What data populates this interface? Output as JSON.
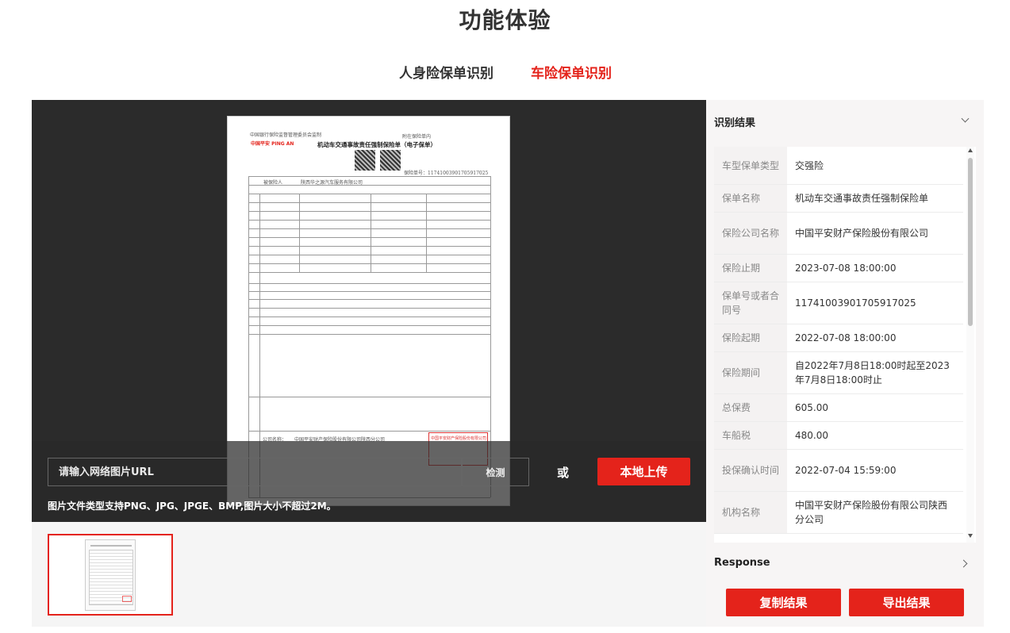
{
  "page": {
    "title": "功能体验"
  },
  "tabs": [
    {
      "label": "人身险保单识别",
      "active": false
    },
    {
      "label": "车险保单识别",
      "active": true
    }
  ],
  "document": {
    "header_left": "中国银行保险监督管理委员会监制",
    "brand": "中国平安 PING AN",
    "header_right": "附在保险单内",
    "title": "机动车交通事故责任强制保险单（电子保单）",
    "policy_no_label": "保险单号：11741003901705917025",
    "insured_label": "被保险人",
    "insured_value": "陕西华之源汽车服务有限公司",
    "company_label": "公司名称：",
    "company_value": "中国平安财产保险股份有限公司陕西分公司",
    "stamp_text": "中国平安财产保险股份有限公司"
  },
  "upload": {
    "url_placeholder": "请输入网络图片URL",
    "check_label": "检测",
    "or_label": "或",
    "upload_label": "本地上传",
    "hint": "图片文件类型支持PNG、JPG、JPGE、BMP,图片大小不超过2M。"
  },
  "results": {
    "header": "识别结果",
    "rows": [
      {
        "key": "车型保单类型",
        "value": "交强险"
      },
      {
        "key": "保单名称",
        "value": "机动车交通事故责任强制保险单"
      },
      {
        "key": "保险公司名称",
        "value": "中国平安财产保险股份有限公司"
      },
      {
        "key": "保险止期",
        "value": "2023-07-08 18:00:00"
      },
      {
        "key": "保单号或者合同号",
        "value": "11741003901705917025"
      },
      {
        "key": "保险起期",
        "value": "2022-07-08 18:00:00"
      },
      {
        "key": "保险期间",
        "value": "自2022年7月8日18:00时起至2023年7月8日18:00时止"
      },
      {
        "key": "总保费",
        "value": "605.00"
      },
      {
        "key": "车船税",
        "value": "480.00"
      },
      {
        "key": "投保确认时间",
        "value": "2022-07-04 15:59:00"
      },
      {
        "key": "机构名称",
        "value": "中国平安财产保险股份有限公司陕西分公司"
      }
    ],
    "response_label": "Response",
    "copy_label": "复制结果",
    "export_label": "导出结果"
  }
}
